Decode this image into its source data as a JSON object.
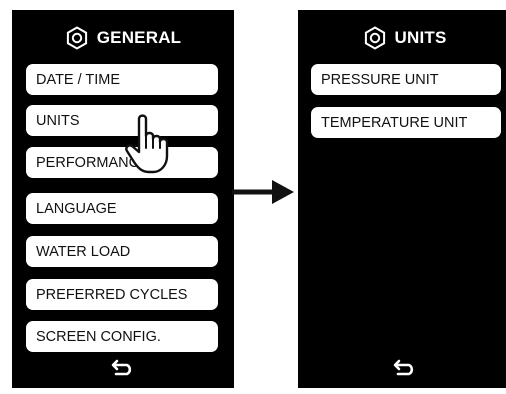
{
  "left_screen": {
    "title": "GENERAL",
    "icon": "gear-icon",
    "items": [
      {
        "label": "DATE / TIME"
      },
      {
        "label": "UNITS"
      },
      {
        "label": "PERFORMANCE"
      },
      {
        "label": "LANGUAGE"
      },
      {
        "label": "WATER LOAD"
      },
      {
        "label": "PREFERRED CYCLES"
      },
      {
        "label": "SCREEN CONFIG."
      }
    ],
    "back_icon": "back-arrow-icon"
  },
  "right_screen": {
    "title": "UNITS",
    "icon": "gear-icon",
    "items": [
      {
        "label": "PRESSURE UNIT"
      },
      {
        "label": "TEMPERATURE UNIT"
      }
    ],
    "back_icon": "back-arrow-icon"
  },
  "colors": {
    "screen_background": "#000000",
    "button_background": "#ffffff",
    "text_on_button": "#111111",
    "header_text": "#ffffff"
  }
}
